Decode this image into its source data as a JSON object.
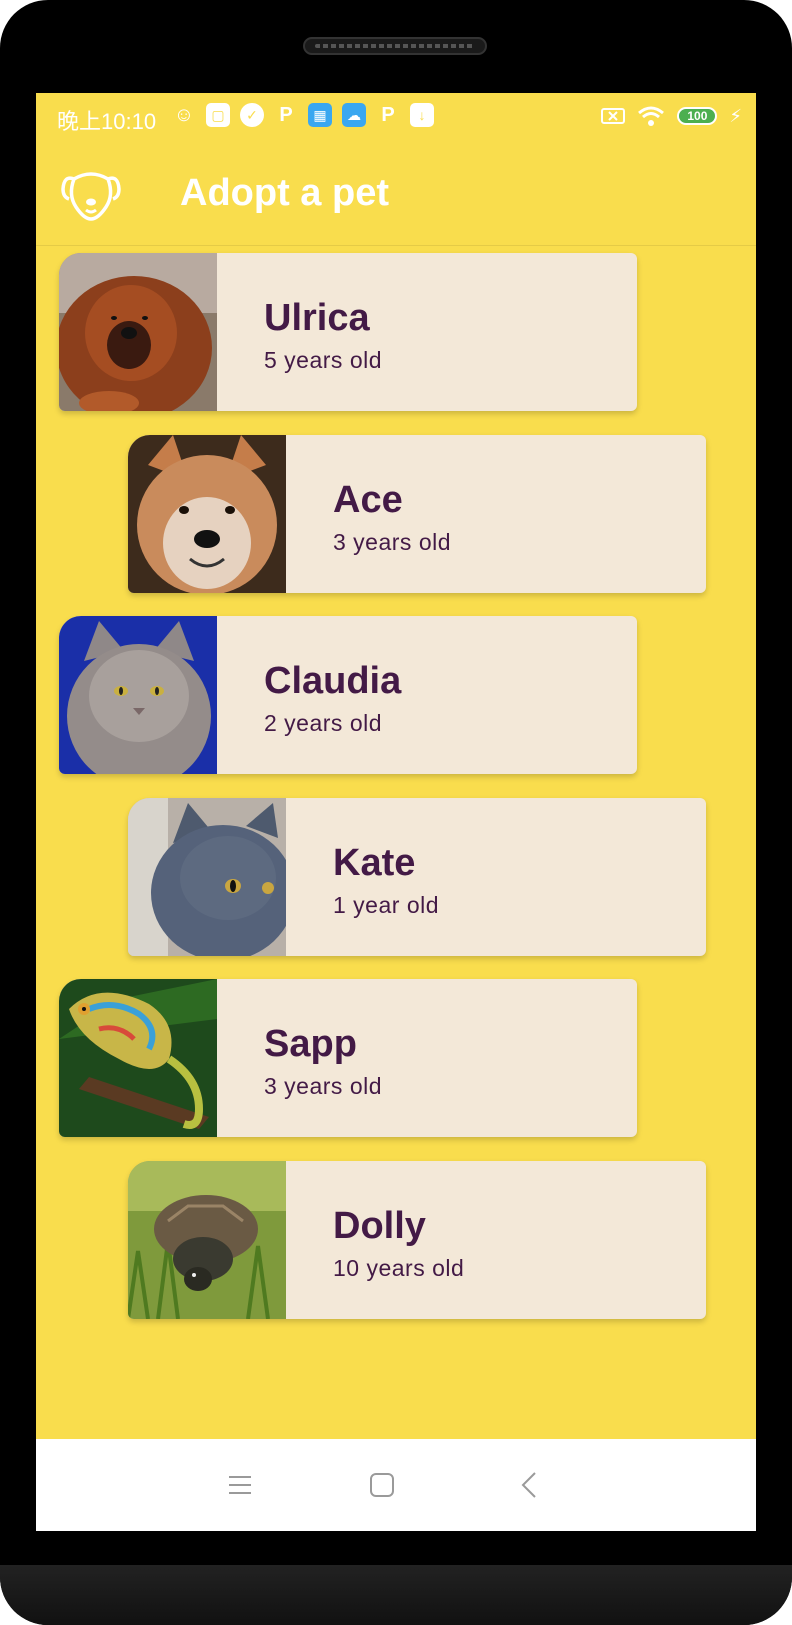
{
  "status_bar": {
    "time": "晚上10:10",
    "battery": "100"
  },
  "app_bar": {
    "title": "Adopt a pet",
    "logo_icon": "dog-face-icon"
  },
  "pets": [
    {
      "name": "Ulrica",
      "age": "5 years old",
      "photo": "tibetan-mastiff-photo"
    },
    {
      "name": "Ace",
      "age": "3 years old",
      "photo": "akita-dog-photo"
    },
    {
      "name": "Claudia",
      "age": "2 years old",
      "photo": "grey-persian-cat-photo"
    },
    {
      "name": "Kate",
      "age": "1 year old",
      "photo": "british-shorthair-cat-photo"
    },
    {
      "name": "Sapp",
      "age": "3 years old",
      "photo": "chameleon-photo"
    },
    {
      "name": "Dolly",
      "age": "10 years old",
      "photo": "turtle-photo"
    }
  ],
  "nav_bar": {
    "icons": [
      "menu-icon",
      "home-icon",
      "back-icon"
    ]
  },
  "colors": {
    "background": "#f9dd4d",
    "card": "#f3e8d8",
    "text": "#431a46"
  }
}
